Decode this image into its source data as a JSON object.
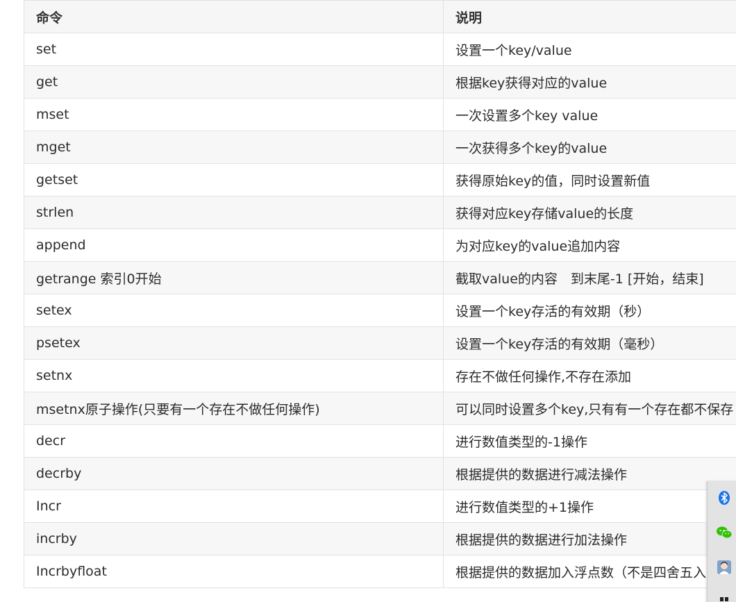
{
  "table": {
    "headers": [
      "命令",
      "说明"
    ],
    "rows": [
      [
        "set",
        "设置一个key/value"
      ],
      [
        "get",
        "根据key获得对应的value"
      ],
      [
        "mset",
        "一次设置多个key value"
      ],
      [
        "mget",
        "一次获得多个key的value"
      ],
      [
        "getset",
        "获得原始key的值，同时设置新值"
      ],
      [
        "strlen",
        "获得对应key存储value的长度"
      ],
      [
        "append",
        "为对应key的value追加内容"
      ],
      [
        "getrange 索引0开始",
        "截取value的内容　到末尾-1 [开始，结束]"
      ],
      [
        "setex",
        "设置一个key存活的有效期（秒）"
      ],
      [
        "psetex",
        "设置一个key存活的有效期（毫秒）"
      ],
      [
        "setnx",
        "存在不做任何操作,不存在添加"
      ],
      [
        "msetnx原子操作(只要有一个存在不做任何操作)",
        "可以同时设置多个key,只有有一个存在都不保存"
      ],
      [
        "decr",
        "进行数值类型的-1操作"
      ],
      [
        "decrby",
        "根据提供的数据进行减法操作"
      ],
      [
        "Incr",
        "进行数值类型的+1操作"
      ],
      [
        "incrby",
        "根据提供的数据进行加法操作"
      ],
      [
        "Incrbyfloat",
        "根据提供的数据加入浮点数（不是四舍五入）"
      ]
    ]
  },
  "tray": {
    "icons": [
      "bluetooth-icon",
      "wechat-icon",
      "avatar-icon",
      "grid-icon"
    ],
    "colors": {
      "bluetooth": "#1a73e8",
      "wechat": "#2dc100"
    }
  }
}
